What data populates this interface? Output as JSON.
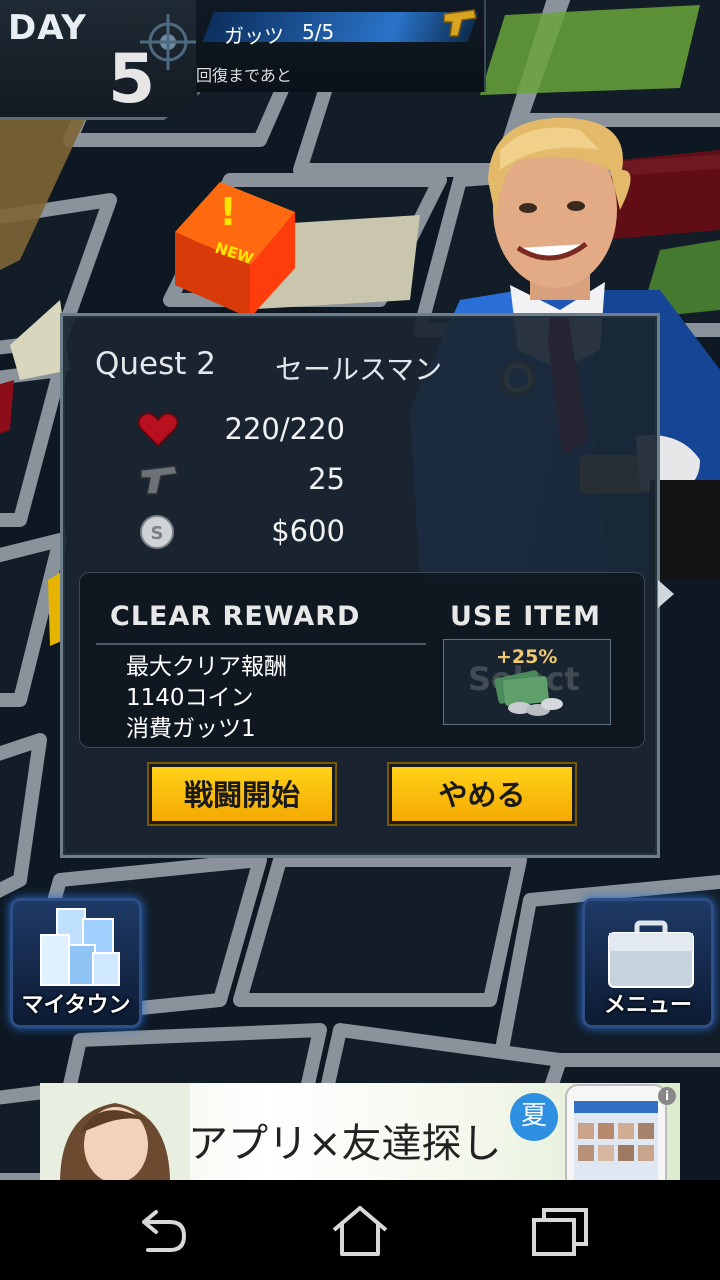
{
  "hud": {
    "day_label": "DAY",
    "day_number": "5",
    "guts_label": "ガッツ",
    "guts_value": "5/5",
    "recover_label": "回復まであと"
  },
  "map": {
    "new_marker_label": "NEW"
  },
  "quest": {
    "title": "Quest 2",
    "name": "セールスマン",
    "hp": "220/220",
    "attack": "25",
    "money": "$600",
    "clear_reward_title": "CLEAR REWARD",
    "reward_lines": [
      "最大クリア報酬",
      "1140コイン",
      "消費ガッツ1"
    ],
    "use_item_title": "USE ITEM",
    "item_ghost_text": "Select",
    "item_bonus": "+25%",
    "start_button": "戦闘開始",
    "cancel_button": "やめる"
  },
  "buttons": {
    "mytown": "マイタウン",
    "menu": "メニュー"
  },
  "ad": {
    "text": "アプリ×友達探し",
    "badge": "夏",
    "info": "i"
  },
  "colors": {
    "button_yellow": "#ffc20e",
    "panel_bg": "#1a2632",
    "accent_blue": "#2a74c9"
  }
}
